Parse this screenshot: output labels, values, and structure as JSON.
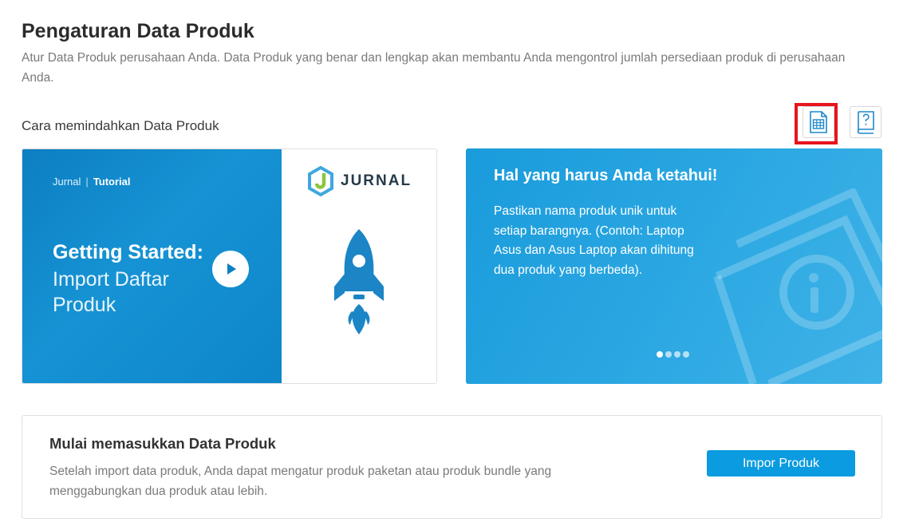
{
  "header": {
    "title": "Pengaturan Data Produk",
    "description": "Atur Data Produk perusahaan Anda. Data Produk yang benar dan lengkap akan membantu Anda mengontrol jumlah persediaan produk di perusahaan Anda."
  },
  "section": {
    "title": "Cara memindahkan Data Produk"
  },
  "toolbar": {
    "spreadsheet_icon": "spreadsheet-icon",
    "guide_icon": "help-book-icon",
    "highlight_color": "#e8141c"
  },
  "video": {
    "brand": "Jurnal",
    "separator": "|",
    "category": "Tutorial",
    "title": "Getting Started:",
    "subtitle": "Import Daftar Produk",
    "logo_text": "JURNAL",
    "play_icon": "play-icon",
    "colors": {
      "panel": "#0c7fc2",
      "rocket": "#1b85c6"
    }
  },
  "info": {
    "title": "Hal yang harus Anda ketahui!",
    "text": "Pastikan nama produk unik untuk setiap barangnya. (Contoh: Laptop Asus dan Asus Laptop akan dihitung dua produk yang berbeda).",
    "slides_total": 4,
    "slide_active": 1,
    "color": "#2aa7e2"
  },
  "import": {
    "title": "Mulai memasukkan Data Produk",
    "description": "Setelah import data produk, Anda dapat mengatur produk paketan atau produk bundle yang menggabungkan dua produk atau lebih.",
    "button_label": "Impor Produk",
    "button_color": "#0a9be0"
  }
}
